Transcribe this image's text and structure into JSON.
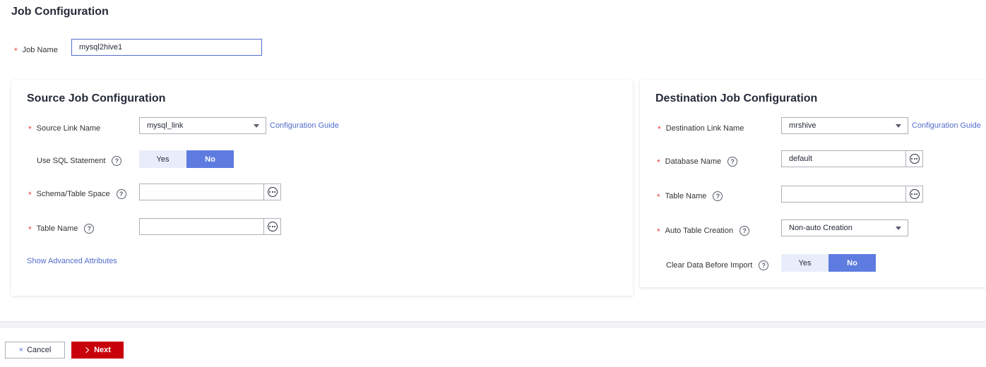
{
  "page": {
    "title": "Job Configuration"
  },
  "job": {
    "name_label": "Job Name",
    "name_value": "mysql2hive1"
  },
  "source": {
    "title": "Source Job Configuration",
    "link_label": "Source Link Name",
    "link_value": "mysql_link",
    "config_guide": "Configuration Guide",
    "sql_label": "Use SQL Statement",
    "sql_yes": "Yes",
    "sql_no": "No",
    "sql_selected": "No",
    "schema_label": "Schema/Table Space",
    "schema_value": "",
    "table_label": "Table Name",
    "table_value": "",
    "advanced_link": "Show Advanced Attributes"
  },
  "destination": {
    "title": "Destination Job Configuration",
    "link_label": "Destination Link Name",
    "link_value": "mrshive",
    "config_guide": "Configuration Guide",
    "db_label": "Database Name",
    "db_value": "default",
    "table_label": "Table Name",
    "table_value": "",
    "auto_label": "Auto Table Creation",
    "auto_value": "Non-auto Creation",
    "clear_label": "Clear Data Before Import",
    "clear_yes": "Yes",
    "clear_no": "No",
    "clear_selected": "No"
  },
  "footer": {
    "cancel_label": "Cancel",
    "next_label": "Next"
  },
  "icons": {
    "required": "*",
    "help": "?",
    "more": "more-icon",
    "dropdown": "caret-down-icon",
    "cancel": "×",
    "next": "chevron-right-icon"
  },
  "colors": {
    "accent": "#5e7ce0",
    "link": "#526ecc",
    "primary_button": "#c7000b",
    "required": "#e8403c"
  }
}
